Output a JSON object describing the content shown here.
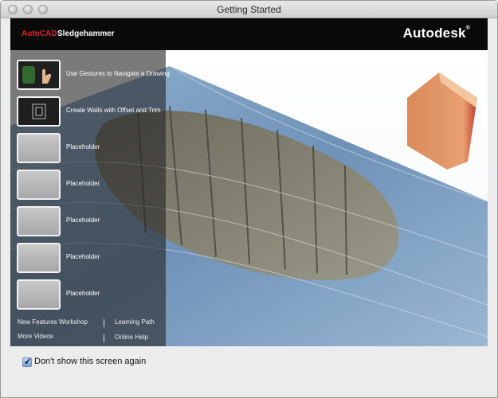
{
  "window": {
    "title": "Getting Started"
  },
  "header": {
    "product_prefix": "AutoCAD",
    "product_name": "Sledgehammer",
    "brand": "Autodesk",
    "brand_mark": "®",
    "colors": {
      "bar": "#0a0a0a",
      "prefix": "#d8262b"
    }
  },
  "sidebar": {
    "items": [
      {
        "label": "Use Gestures to Navigate a Drawing",
        "icon": "gesture-thumbnail"
      },
      {
        "label": "Create Walls with Offset and Trim",
        "icon": "walls-thumbnail"
      },
      {
        "label": "Placeholder",
        "icon": "placeholder-thumbnail"
      },
      {
        "label": "Placeholder",
        "icon": "placeholder-thumbnail"
      },
      {
        "label": "Placeholder",
        "icon": "placeholder-thumbnail"
      },
      {
        "label": "Placeholder",
        "icon": "placeholder-thumbnail"
      },
      {
        "label": "Placeholder",
        "icon": "placeholder-thumbnail"
      }
    ],
    "links": {
      "new_features": "New Features Workshop",
      "learning_path": "Learning Path",
      "more_videos": "More Videos",
      "online_help": "Online Help",
      "separator": "|"
    }
  },
  "footer": {
    "checkbox_label": "Don't show this screen again",
    "checked": true,
    "check_glyph": "✓"
  }
}
